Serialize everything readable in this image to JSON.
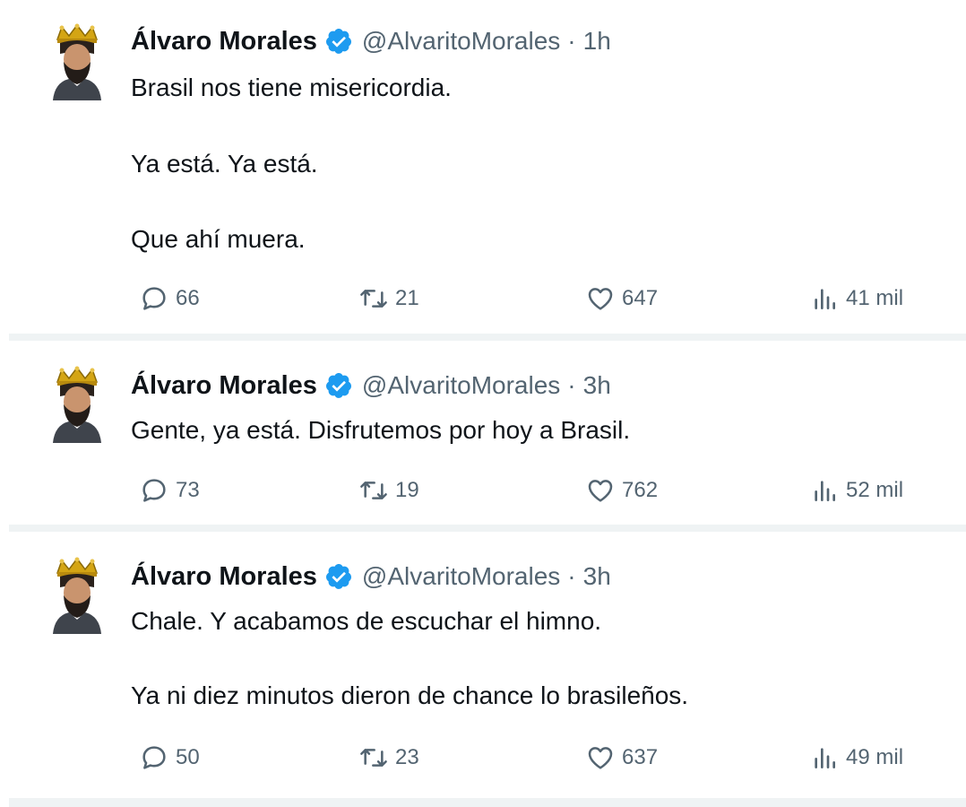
{
  "tweets": [
    {
      "author": {
        "name": "Álvaro Morales",
        "handle": "@AlvaritoMorales",
        "verified": true,
        "avatar_icon": "crowned-man-avatar-icon"
      },
      "separator": "·",
      "time": "1h",
      "paragraphs": [
        "Brasil nos tiene misericordia.",
        "Ya está. Ya está.",
        "Que ahí muera."
      ],
      "stats": {
        "replies": "66",
        "retweets": "21",
        "likes": "647",
        "views": "41 mil"
      }
    },
    {
      "author": {
        "name": "Álvaro Morales",
        "handle": "@AlvaritoMorales",
        "verified": true,
        "avatar_icon": "crowned-man-avatar-icon"
      },
      "separator": "·",
      "time": "3h",
      "paragraphs": [
        "Gente, ya está. Disfrutemos por hoy a Brasil."
      ],
      "stats": {
        "replies": "73",
        "retweets": "19",
        "likes": "762",
        "views": "52 mil"
      }
    },
    {
      "author": {
        "name": "Álvaro Morales",
        "handle": "@AlvaritoMorales",
        "verified": true,
        "avatar_icon": "crowned-man-avatar-icon"
      },
      "separator": "·",
      "time": "3h",
      "paragraphs": [
        "Chale. Y acabamos de escuchar el himno.",
        "Ya ni diez minutos dieron de chance lo brasileños."
      ],
      "stats": {
        "replies": "50",
        "retweets": "23",
        "likes": "637",
        "views": "49 mil"
      }
    }
  ],
  "colors": {
    "text": "#0f1419",
    "secondary": "#536471",
    "verified_badge": "#1d9bf0",
    "divider": "#eff3f4"
  }
}
